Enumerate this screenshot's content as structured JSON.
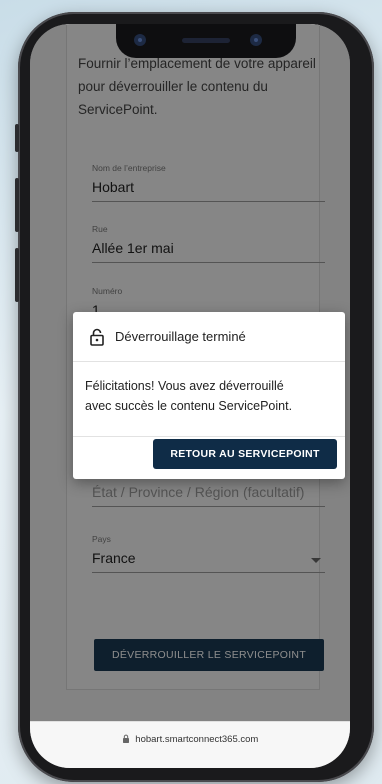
{
  "intro": {
    "line1": "Fournir l’emplacement de votre appareil",
    "line2": "pour déverrouiller le contenu du",
    "line3": "ServicePoint."
  },
  "form": {
    "company": {
      "label": "Nom de l’entreprise",
      "value": "Hobart"
    },
    "street": {
      "label": "Rue",
      "value": "Allée 1er mai"
    },
    "number": {
      "label": "Numéro",
      "value": "1"
    },
    "state": {
      "placeholder": "État / Province / Région (facultatif)"
    },
    "country": {
      "label": "Pays",
      "value": "France"
    },
    "submit_label": "DÉVERROUILLER LE SERVICEPOINT"
  },
  "dialog": {
    "title": "Déverrouillage terminé",
    "message_line1": "Félicitations! Vous avez déverrouillé",
    "message_line2": "avec succès le contenu ServicePoint.",
    "button_label": "RETOUR AU SERVICEPOINT",
    "icon": "lock-open-icon"
  },
  "browser": {
    "url": "hobart.smartconnect365.com",
    "icon": "lock-icon"
  }
}
